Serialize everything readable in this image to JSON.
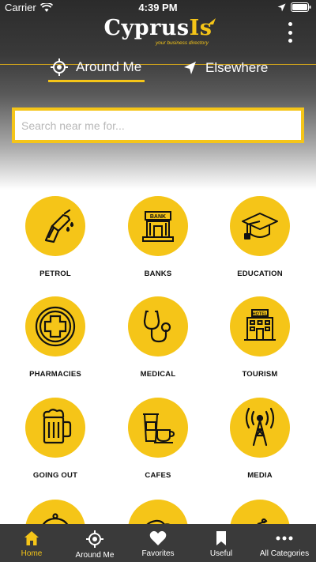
{
  "status": {
    "carrier": "Carrier",
    "time": "4:39 PM"
  },
  "app": {
    "logo_main": "Cyprus",
    "logo_accent": "Is",
    "tagline": "your business directory"
  },
  "mode_tabs": [
    {
      "label": "Around Me",
      "icon": "location-target-icon",
      "active": true
    },
    {
      "label": "Elsewhere",
      "icon": "navigation-arrow-icon",
      "active": false
    }
  ],
  "search": {
    "placeholder": "Search near me for...",
    "value": ""
  },
  "categories": [
    {
      "label": "PETROL",
      "icon": "fuel-nozzle-icon"
    },
    {
      "label": "BANKS",
      "icon": "bank-icon"
    },
    {
      "label": "EDUCATION",
      "icon": "graduation-cap-icon"
    },
    {
      "label": "PHARMACIES",
      "icon": "pharmacy-cross-icon"
    },
    {
      "label": "MEDICAL",
      "icon": "stethoscope-icon"
    },
    {
      "label": "TOURISM",
      "icon": "hotel-icon"
    },
    {
      "label": "GOING OUT",
      "icon": "beer-mug-icon"
    },
    {
      "label": "CAFES",
      "icon": "coffee-cup-icon"
    },
    {
      "label": "MEDIA",
      "icon": "broadcast-tower-icon"
    },
    {
      "label": "",
      "icon": "food-cloche-icon"
    },
    {
      "label": "",
      "icon": "bakery-icon"
    },
    {
      "label": "",
      "icon": "car-icon"
    }
  ],
  "tabbar": [
    {
      "label": "Home",
      "icon": "home-icon",
      "active": true
    },
    {
      "label": "Around Me",
      "icon": "location-target-icon",
      "active": false
    },
    {
      "label": "Favorites",
      "icon": "heart-icon",
      "active": false
    },
    {
      "label": "Useful",
      "icon": "bookmark-icon",
      "active": false
    },
    {
      "label": "All Categories",
      "icon": "more-dots-icon",
      "active": false
    }
  ],
  "colors": {
    "accent": "#f5c518",
    "header_dark": "#2b2b2b",
    "tabbar_bg": "#3a3a3a"
  }
}
